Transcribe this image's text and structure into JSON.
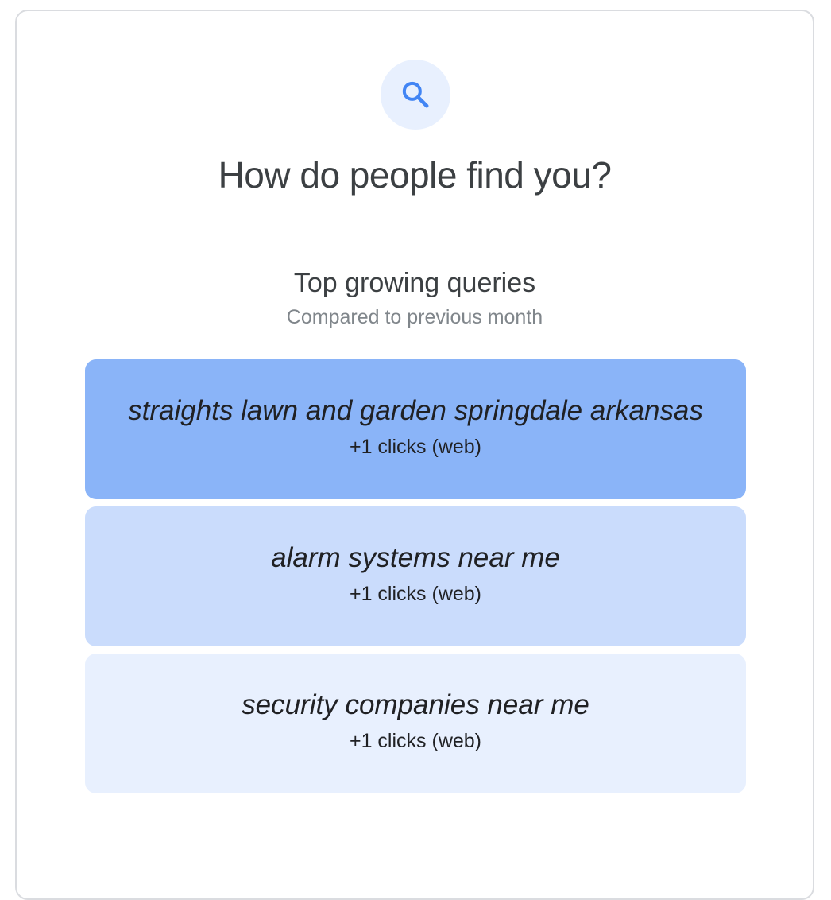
{
  "header": {
    "icon": "search-icon",
    "title": "How do people find you?"
  },
  "section": {
    "title": "Top growing queries",
    "subtitle": "Compared to previous month"
  },
  "colors": {
    "icon_bg": "#e8f0fe",
    "icon_fg": "#4285f4",
    "query_1_bg": "#8ab4f8",
    "query_2_bg": "#cadcfc",
    "query_3_bg": "#e8f0fe"
  },
  "queries": [
    {
      "text": "straights lawn and garden springdale arkansas",
      "clicks": "+1 clicks (web)"
    },
    {
      "text": "alarm systems near me",
      "clicks": "+1 clicks (web)"
    },
    {
      "text": "security companies near me",
      "clicks": "+1 clicks (web)"
    }
  ]
}
